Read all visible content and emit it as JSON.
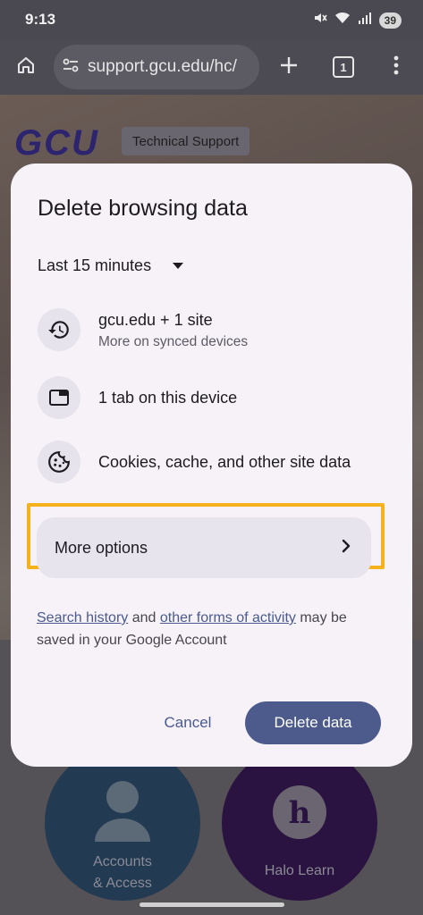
{
  "status_bar": {
    "time": "9:13",
    "battery": "39",
    "icons": [
      "mute-icon",
      "wifi-icon",
      "signal-icon",
      "battery-icon"
    ]
  },
  "browser": {
    "url": "support.gcu.edu/hc/",
    "tab_count": "1",
    "icons": [
      "home-icon",
      "site-settings-icon",
      "new-tab-icon",
      "tab-switcher-icon",
      "overflow-menu-icon"
    ]
  },
  "page": {
    "logo_text": "GCU",
    "chip_label": "Technical Support",
    "cards": [
      {
        "label_line1": "Accounts",
        "label_line2": "& Access"
      },
      {
        "label_line1": "Halo Learn"
      }
    ]
  },
  "dialog": {
    "title": "Delete browsing data",
    "time_range": "Last 15 minutes",
    "items": [
      {
        "primary": "gcu.edu + 1 site",
        "secondary": "More on synced devices",
        "icon": "history-icon"
      },
      {
        "primary": "1 tab on this device",
        "icon": "tab-icon"
      },
      {
        "primary": "Cookies, cache, and other site data",
        "icon": "cookie-icon"
      }
    ],
    "more_options_label": "More options",
    "notice": {
      "link1": "Search history",
      "middle": " and ",
      "link2": "other forms of activity",
      "rest": " may be saved in your Google Account"
    },
    "cancel_label": "Cancel",
    "delete_label": "Delete data"
  },
  "colors": {
    "accent": "#4d5b8c",
    "highlight_frame": "#f5b21c",
    "dialog_bg": "#f6f2f8"
  }
}
